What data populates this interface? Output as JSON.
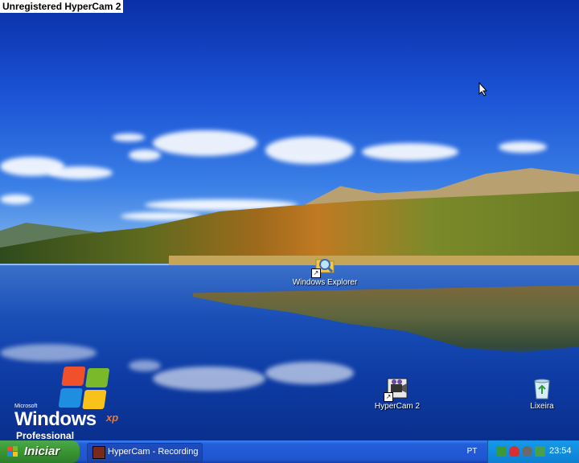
{
  "watermark": "Unregistered HyperCam 2",
  "desktop_icons": [
    {
      "label": "Windows Explorer",
      "icon": "folder-magnifier-icon"
    },
    {
      "label": "HyperCam 2",
      "icon": "hypercam-icon"
    },
    {
      "label": "Lixeira",
      "icon": "recycle-bin-icon"
    }
  ],
  "wallpaper_logo": {
    "microsoft": "Microsoft",
    "windows": "Windows",
    "xp": "xp",
    "edition": "Professional"
  },
  "taskbar": {
    "start_label": "Iniciar",
    "task_button_label": "HyperCam - Recording",
    "language": "PT",
    "clock": "23:54"
  },
  "colors": {
    "taskbar": "#245edb",
    "start_button": "#3c9a36",
    "tray": "#1290e2"
  }
}
